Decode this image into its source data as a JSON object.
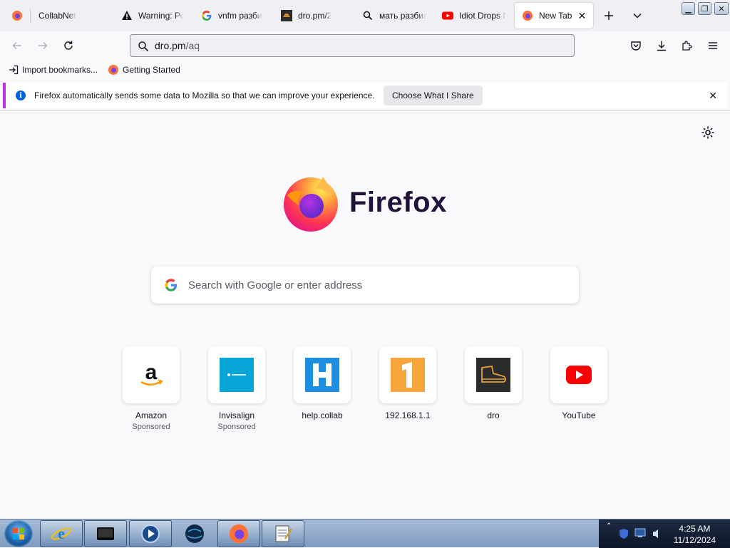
{
  "tabs": [
    {
      "title": "CollabNet",
      "icon": "firefox-icon"
    },
    {
      "title": "Warning: Pot",
      "icon": "warning-icon"
    },
    {
      "title": "vnfm разби",
      "icon": "google-icon"
    },
    {
      "title": "dro.pm/2",
      "icon": "dro-icon"
    },
    {
      "title": "мать разбил",
      "icon": "search-icon"
    },
    {
      "title": "Idiot Drops N",
      "icon": "youtube-icon"
    },
    {
      "title": "New Tab",
      "icon": "firefox-icon",
      "active": true
    }
  ],
  "navbar": {
    "url_host": "dro.pm",
    "url_path": "/aq"
  },
  "bookmarks": [
    {
      "label": "Import bookmarks...",
      "icon": "import-icon"
    },
    {
      "label": "Getting Started",
      "icon": "firefox-icon"
    }
  ],
  "notification": {
    "message": "Firefox automatically sends some data to Mozilla so that we can improve your experience.",
    "button": "Choose What I Share"
  },
  "newtab": {
    "brand": "Firefox",
    "search_placeholder": "Search with Google or enter address",
    "top_sites": [
      {
        "label": "Amazon",
        "sponsored": "Sponsored",
        "icon": "amazon-icon"
      },
      {
        "label": "Invisalign",
        "sponsored": "Sponsored",
        "icon": "invisalign-icon"
      },
      {
        "label": "help.collab",
        "sponsored": "",
        "icon": "helpcollab-icon"
      },
      {
        "label": "192.168.1.1",
        "sponsored": "",
        "icon": "router-icon"
      },
      {
        "label": "dro",
        "sponsored": "",
        "icon": "dro-boot-icon"
      },
      {
        "label": "YouTube",
        "sponsored": "",
        "icon": "youtube-icon"
      }
    ]
  },
  "taskbar": {
    "time": "4:25 AM",
    "date": "11/12/2024",
    "apps": [
      "internet-explorer-icon",
      "media-center-icon",
      "media-player-icon",
      "globe-icon",
      "firefox-icon",
      "notepad-icon"
    ]
  },
  "colors": {
    "accent": "#0060df",
    "notification_border": "#b833e1",
    "wordmark": "#20123a"
  }
}
